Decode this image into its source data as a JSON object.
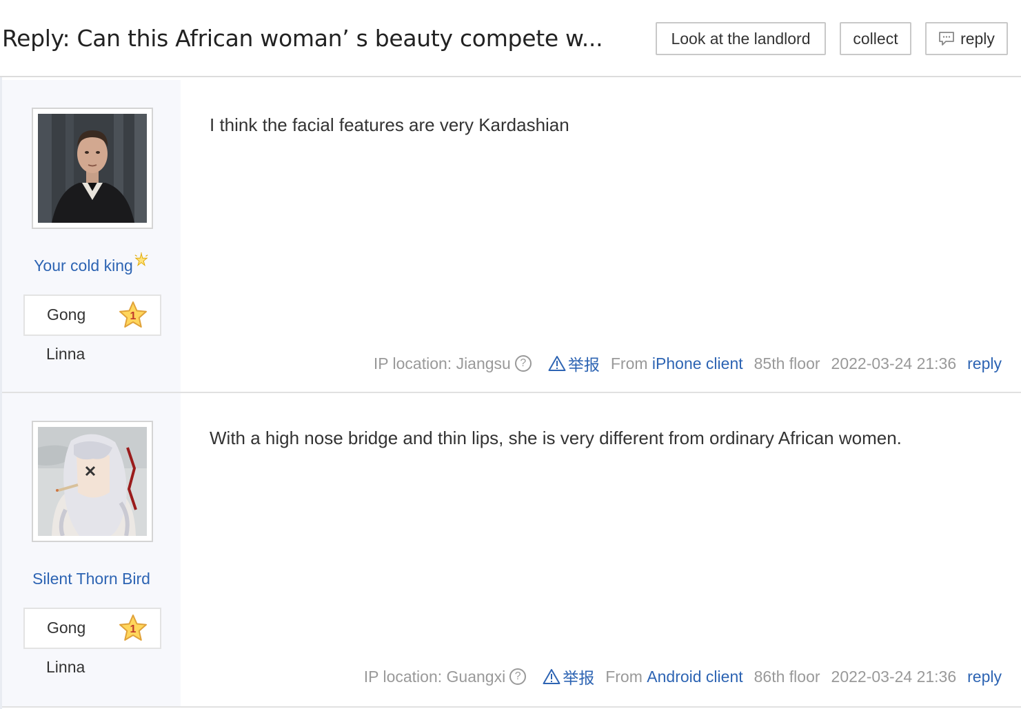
{
  "header": {
    "title": "Reply: Can this African woman’ s beauty compete w...",
    "buttons": {
      "landlord": "Look at the landlord",
      "collect": "collect",
      "reply": "reply"
    }
  },
  "posts": [
    {
      "username": "Your cold king",
      "level_name": "Gong",
      "level": "1",
      "subtitle": "Linna",
      "content": "I think the facial features are very Kardashian",
      "ip": "IP location: Jiangsu",
      "report": "举报",
      "from": "From",
      "client": "iPhone client",
      "floor": "85th floor",
      "time": "2022-03-24 21:36",
      "reply": "reply"
    },
    {
      "username": "Silent Thorn Bird",
      "level_name": "Gong",
      "level": "1",
      "subtitle": "Linna",
      "content": "With a high nose bridge and thin lips, she is very different from ordinary African women.",
      "ip": "IP location: Guangxi",
      "report": "举报",
      "from": "From",
      "client": "Android client",
      "floor": "86th floor",
      "time": "2022-03-24 21:36",
      "reply": "reply"
    }
  ],
  "colors": {
    "link": "#2d64b3",
    "muted": "#999999",
    "sidebar": "#f7f8fc"
  },
  "icons": [
    "chat-bubble-icon",
    "vip-sparkle-icon",
    "level-star-icon",
    "help-circle-icon",
    "warning-triangle-icon"
  ]
}
